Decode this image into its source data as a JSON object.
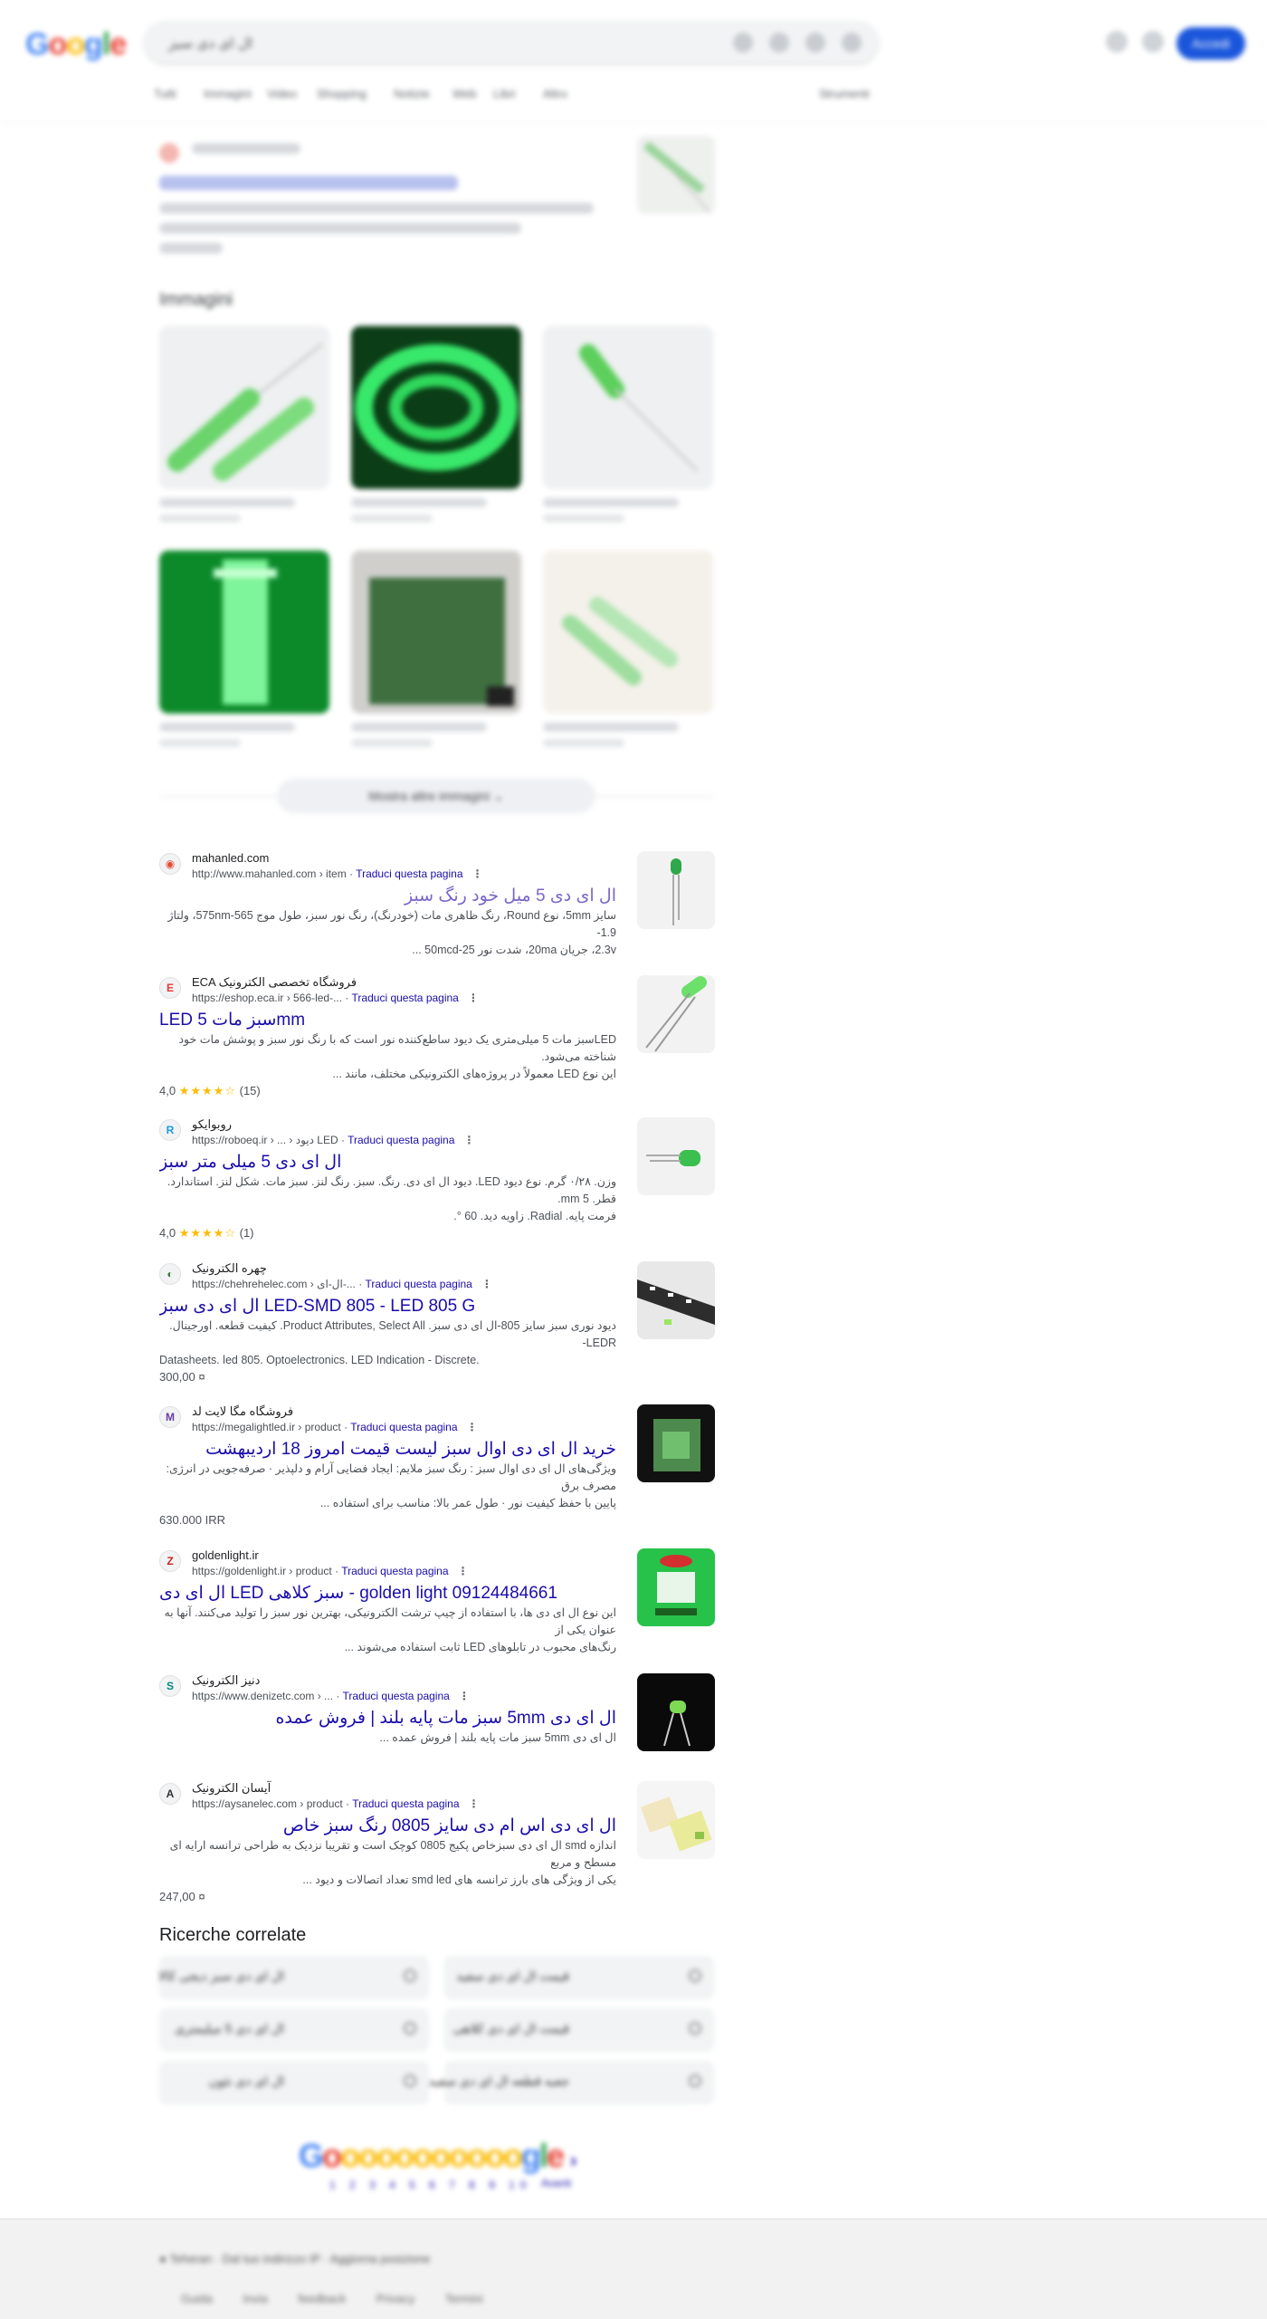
{
  "header": {
    "logo_letters": [
      "G",
      "o",
      "o",
      "g",
      "l",
      "e"
    ],
    "query": "ال ای دی سبز",
    "signin_label": "Accedi",
    "tabs": [
      "Tutti",
      "Immagini",
      "Video",
      "Shopping",
      "Notizie",
      "Web",
      "Libri",
      "Altro"
    ],
    "tools_label": "Strumenti"
  },
  "images": {
    "section_title": "Immagini",
    "more_label": "Mostra altre immagini ⌄"
  },
  "results": [
    {
      "site_name": "mahanled.com",
      "url": "http://www.mahanled.com › item",
      "translate": "Traduci questa pagina",
      "title": "ال ای دی 5 میل خود رنگ سبز",
      "snippet_lines": [
        "سایز 5mm، نوع Round، رنگ ظاهری مات (خودرنگ)، رنگ نور سبز، طول موج 575nm-565، ولتاژ 1.9-",
        "2.3v، جریان 20ma، شدت نور 50mcd-25 ..."
      ],
      "meta": ""
    },
    {
      "site_name": "ECA فروشگاه تخصصی الکترونیک",
      "url": "https://eshop.eca.ir › 566-led-...",
      "translate": "Traduci questa pagina",
      "title": "LED سبز مات 5mm",
      "snippet_lines": [
        "LEDسبز مات 5 میلی‌متری یک دیود ساطع‌کننده نور است که با رنگ نور سبز و پوشش مات خود شناخته می‌شود.",
        "این نوع LED معمولاً در پروژه‌های الکترونیکی مختلف، مانند ..."
      ],
      "rating": "4,0",
      "stars": "★★★★☆",
      "reviews": "(15)"
    },
    {
      "site_name": "روبوایکو",
      "url": "https://roboeq.ir › ... › دیود LED",
      "translate": "Traduci questa pagina",
      "title": "ال ای دی 5 میلی متر سبز",
      "snippet_lines": [
        "وزن. ۰/۲۸ گرم. نوع دیود LED. دیود ال ای دی. رنگ. سبز. رنگ لنز. سبز مات. شکل لنز. استاندارد. قطر. 5 mm.",
        "فرمت پایه. Radial. زاویه دید. 60 °."
      ],
      "rating": "4,0",
      "stars": "★★★★☆",
      "reviews": "(1)"
    },
    {
      "site_name": "چهره الکترونیک",
      "url": "https://chehrehelec.com › ال-ای-...",
      "translate": "Traduci questa pagina",
      "title": "ال ای دی سبز LED-SMD 805 - LED 805 G",
      "snippet_lines": [
        "دیود نوری سبز سایز 805-ال ای دی سبز. Product Attributes, Select All. کیفیت قطعه. اورجینال. LEDR-",
        "Datasheets. led 805. Optoelectronics. LED Indication - Discrete."
      ],
      "meta": "300,00 ¤"
    },
    {
      "site_name": "فروشگاه مگا لایت لد",
      "url": "https://megalightled.ir › product",
      "translate": "Traduci questa pagina",
      "title": "خرید ال ای دی اوال سبز لیست قیمت امروز 18 اردیبهشت",
      "snippet_lines": [
        "ویژگی‌های ال ای دی اوال سبز : رنگ سبز ملایم: ایجاد فضایی آرام و دلپذیر · صرفه‌جویی در انرژی: مصرف برق",
        "پایین با حفظ کیفیت نور · طول عمر بالا: مناسب برای استفاده ..."
      ],
      "meta": "630.000 IRR"
    },
    {
      "site_name": "goldenlight.ir",
      "url": "https://goldenlight.ir › product",
      "translate": "Traduci questa pagina",
      "title": "ال ای دی LED سبز کلاهی - golden light 09124484661",
      "snippet_lines": [
        "این نوع ال ای دی ها، با استفاده از چیپ ترشت الکترونیکی، بهترین نور سبز را تولید می‌کنند. آنها به عنوان یکی از",
        "رنگ‌های محبوب در تابلوهای LED ثابت استفاده می‌شوند ..."
      ],
      "meta": ""
    },
    {
      "site_name": "دنیز الکترونیک",
      "url": "https://www.denizetc.com › ...",
      "translate": "Traduci questa pagina",
      "title": "ال ای دی 5mm سبز مات پایه بلند | فروش عمده",
      "snippet_lines": [
        "ال ای دی 5mm سبز مات پایه بلند | فروش عمده ..."
      ],
      "meta": ""
    },
    {
      "site_name": "آیسان الکترونیک",
      "url": "https://aysanelec.com › product",
      "translate": "Traduci questa pagina",
      "title": "ال ای دی اس ام دی سایز 0805 رنگ سبز خاص",
      "snippet_lines": [
        "اندازه smd ال ای دی سبزخاص پکیج 0805 کوچک است و تقریبا نزدیک به طراحی ترانسه ارایه ای مسطح و مربع",
        "یکی از ویژگی های بارز ترانسه های smd led تعداد اتصالات و دیود ..."
      ],
      "meta": "247,00 ¤"
    }
  ],
  "related": {
    "title": "Ricerche correlate",
    "items": [
      "ال ای دی سبز دیجی کالا",
      "قیمت ال ای دی سفید",
      "ال ای دی 5 میلیمتری",
      "قیمت ال ای دی کلاهی",
      "ال ای دی نئون",
      "جعبه قطعه ال ای دی سفید"
    ]
  },
  "pagination": {
    "pages": "1 2 3 4 5 6 7 8 9 10",
    "next_label": "Avanti"
  },
  "footer": {
    "location": "● Teheran · Dal tuo indirizzo IP · Aggiorna posizione",
    "links": "Guida Invia feedback Privacy Termini"
  },
  "colors": {
    "link": "#1a0dab",
    "accent": "#1a56db",
    "star": "#fbbc04"
  }
}
